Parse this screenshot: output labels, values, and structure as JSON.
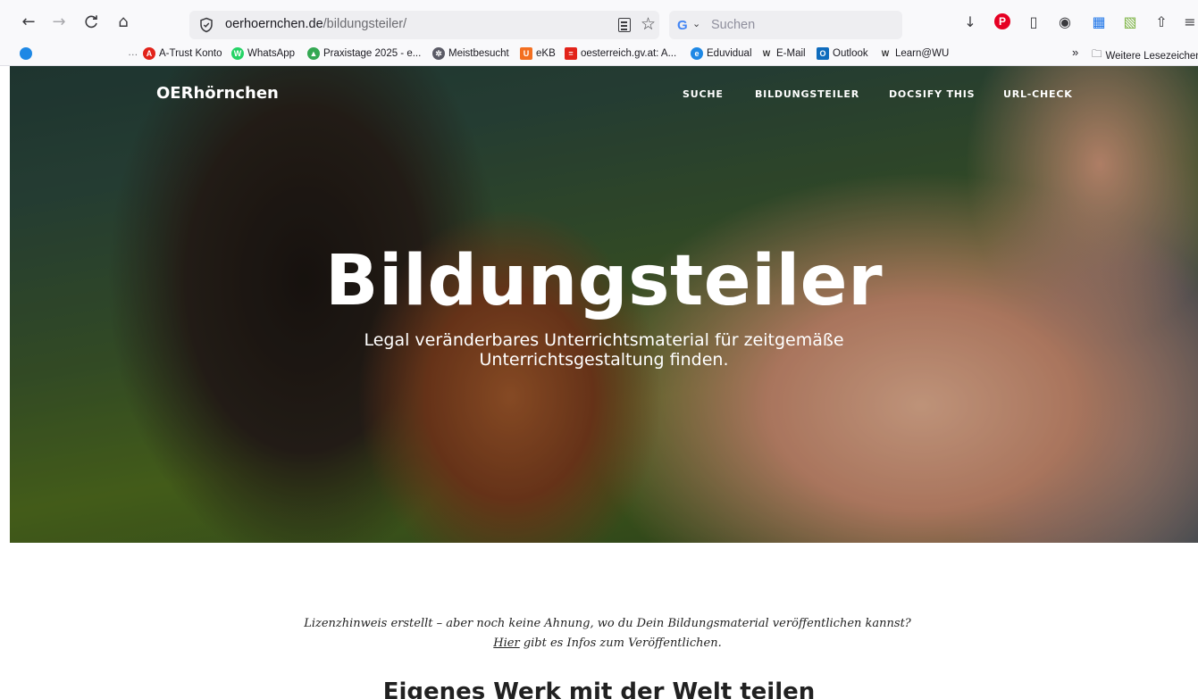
{
  "browser": {
    "url_host": "oerhoernchen.de",
    "url_path": "/bildungsteiler/",
    "search_placeholder": "Suchen",
    "search_engine_badge": "G",
    "icons": {
      "back": "←",
      "forward": "→",
      "reload": "C",
      "home": "⌂",
      "star": "☆",
      "chevron": "⌄",
      "download": "↓",
      "pinterest": "P",
      "sidebar": "▯",
      "account": "◉",
      "extension_a": "▦",
      "extension_b": "▧",
      "share": "⇧",
      "menu": "≡",
      "overflow": "»",
      "folder": "🗀",
      "ellipsis": "…"
    },
    "bookmarks": {
      "items": [
        {
          "label": "A-Trust Konto",
          "color": "#e2231a",
          "glyph": "A"
        },
        {
          "label": "WhatsApp",
          "color": "#25d366",
          "glyph": "W"
        },
        {
          "label": "Praxistage 2025 - e...",
          "color": "#34a853",
          "glyph": "▲"
        },
        {
          "label": "Meistbesucht",
          "color": "#5b5b66",
          "glyph": "✲"
        },
        {
          "label": "eKB",
          "color": "#f36f21",
          "glyph": "U"
        },
        {
          "label": "oesterreich.gv.at: A...",
          "color": "#e2231a",
          "glyph": "="
        },
        {
          "label": "Eduvidual",
          "color": "#1e88e5",
          "glyph": "e"
        },
        {
          "label": "E-Mail",
          "color": "#333333",
          "glyph": "W"
        },
        {
          "label": "Outlook",
          "color": "#0f6cbd",
          "glyph": "O"
        },
        {
          "label": "Learn@WU",
          "color": "#333333",
          "glyph": "W"
        }
      ],
      "other": "Weitere Lesezeichen"
    }
  },
  "site": {
    "brand": "OERhörnchen",
    "nav": [
      "SUCHE",
      "BILDUNGSTEILER",
      "DOCSIFY THIS",
      "URL-CHECK"
    ]
  },
  "hero": {
    "title": "Bildungsteiler",
    "subtitle": "Legal veränderbares Unterrichtsmaterial für zeitgemäße Unterrichtsgestaltung finden."
  },
  "notice": {
    "before": "Lizenzhinweis erstellt – aber noch keine Ahnung, wo du Dein Bildungsmaterial veröffentlichen kannst? ",
    "link": "Hier",
    "after": " gibt es Infos zum Veröffentlichen."
  },
  "section": {
    "heading": "Eigenes Werk mit der Welt teilen"
  }
}
